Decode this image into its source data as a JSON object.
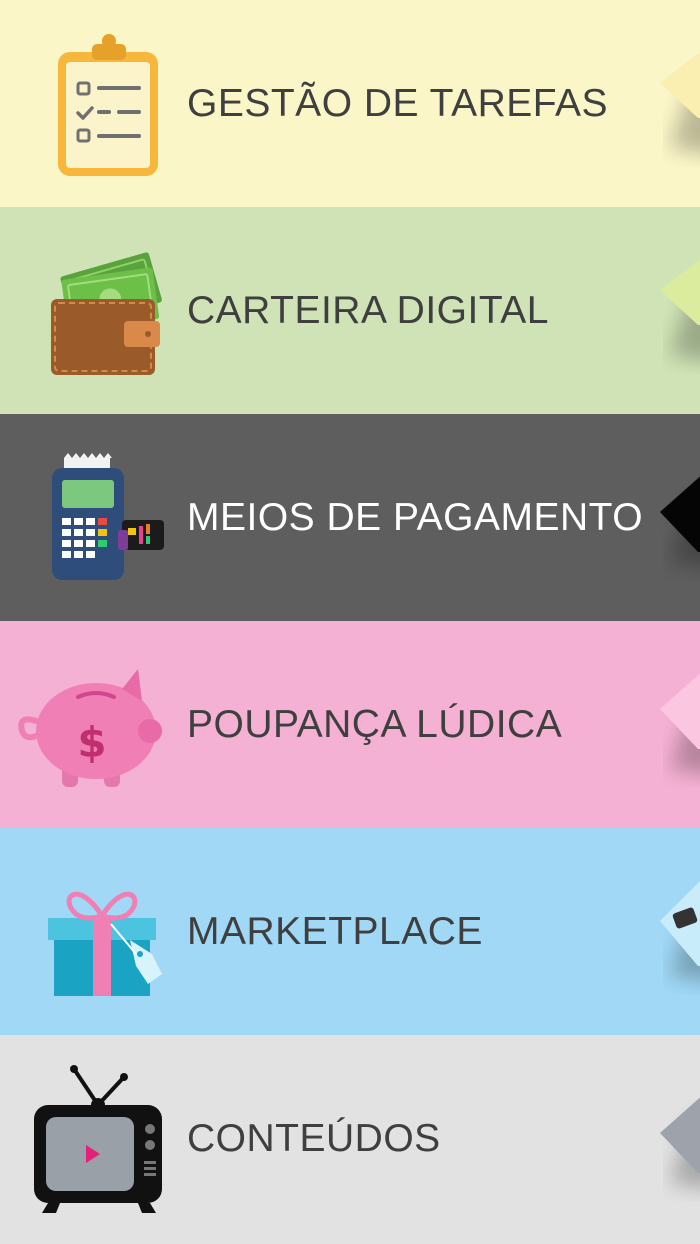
{
  "menu": {
    "items": [
      {
        "label": "GESTÃO DE TAREFAS",
        "icon": "clipboard-checklist-icon",
        "color": "#fbf6c8"
      },
      {
        "label": "CARTEIRA DIGITAL",
        "icon": "wallet-icon",
        "color": "#cfe3b6"
      },
      {
        "label": "MEIOS DE PAGAMENTO",
        "icon": "card-terminal-icon",
        "color": "#5e5e5e"
      },
      {
        "label": "POUPANÇA LÚDICA",
        "icon": "piggy-bank-icon",
        "color": "#f5b1d3"
      },
      {
        "label": "MARKETPLACE",
        "icon": "gift-box-icon",
        "color": "#a0d8f5"
      },
      {
        "label": "CONTEÚDOS",
        "icon": "television-icon",
        "color": "#e2e2e2"
      }
    ]
  }
}
